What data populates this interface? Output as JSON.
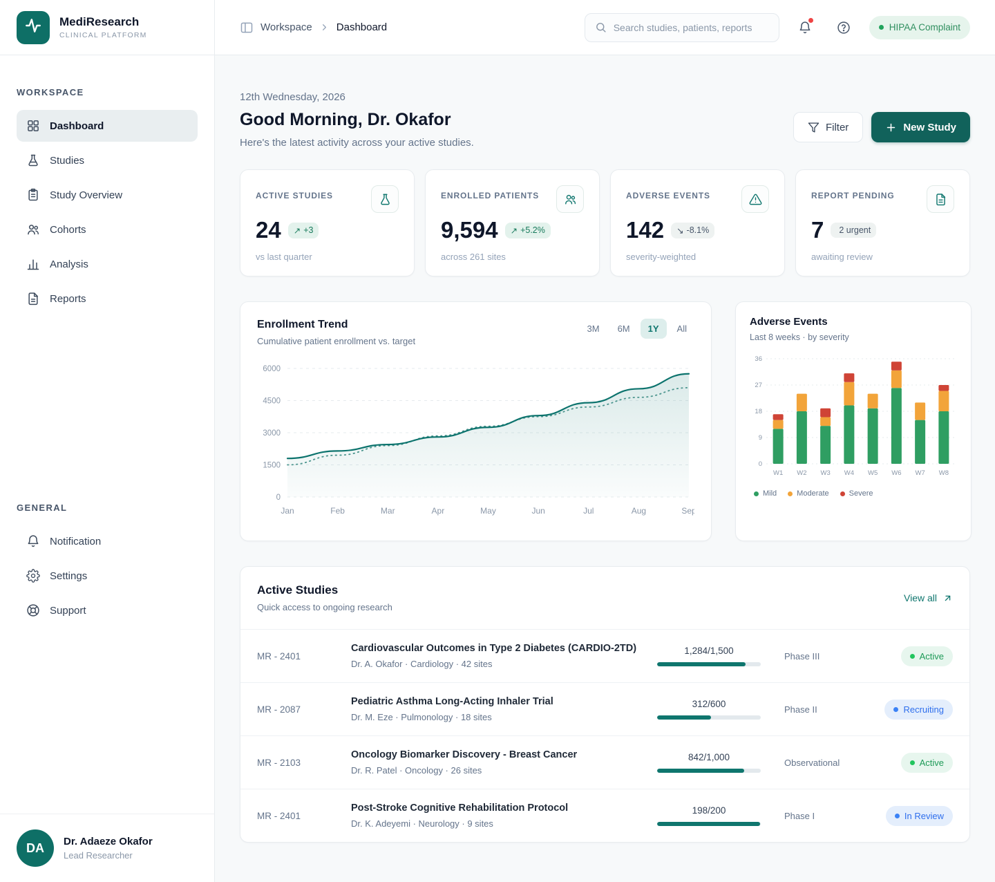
{
  "brand": {
    "name": "MediResearch",
    "tagline": "CLINICAL PLATFORM"
  },
  "topbar": {
    "breadcrumb": {
      "root": "Workspace",
      "current": "Dashboard"
    },
    "search_placeholder": "Search studies, patients, reports",
    "hipaa_badge": "HIPAA Complaint"
  },
  "sidebar": {
    "sections": {
      "workspace": "WORKSPACE",
      "general": "GENERAL"
    },
    "workspace_items": [
      {
        "label": "Dashboard",
        "icon": "grid-icon",
        "active": true
      },
      {
        "label": "Studies",
        "icon": "flask-icon",
        "active": false
      },
      {
        "label": "Study Overview",
        "icon": "clipboard-icon",
        "active": false
      },
      {
        "label": "Cohorts",
        "icon": "users-icon",
        "active": false
      },
      {
        "label": "Analysis",
        "icon": "bar-chart-icon",
        "active": false
      },
      {
        "label": "Reports",
        "icon": "document-icon",
        "active": false
      }
    ],
    "general_items": [
      {
        "label": "Notification",
        "icon": "bell-icon"
      },
      {
        "label": "Settings",
        "icon": "gear-icon"
      },
      {
        "label": "Support",
        "icon": "life-buoy-icon"
      }
    ],
    "user": {
      "initials": "DA",
      "name": "Dr. Adaeze Okafor",
      "role": "Lead Researcher"
    }
  },
  "header": {
    "date": "12th Wednesday, 2026",
    "greeting": "Good Morning, Dr. Okafor",
    "subtitle": "Here's the latest activity across your active studies.",
    "filter_button": "Filter",
    "new_study_button": "New Study"
  },
  "stat_cards": [
    {
      "label": "ACTIVE STUDIES",
      "value": "24",
      "badge": "+3",
      "badge_trend": "up",
      "sub": "vs last quarter",
      "icon": "flask-icon"
    },
    {
      "label": "ENROLLED PATIENTS",
      "value": "9,594",
      "badge": "+5.2%",
      "badge_trend": "up",
      "sub": "across 261 sites",
      "icon": "users-icon"
    },
    {
      "label": "ADVERSE EVENTS",
      "value": "142",
      "badge": "-8.1%",
      "badge_trend": "down",
      "sub": "severity-weighted",
      "icon": "alert-triangle-icon"
    },
    {
      "label": "REPORT PENDING",
      "value": "7",
      "badge": "2 urgent",
      "badge_trend": "neutral",
      "sub": "awaiting review",
      "icon": "file-icon"
    }
  ],
  "chart_data": [
    {
      "type": "area",
      "title": "Enrollment Trend",
      "subtitle": "Cumulative patient enrollment vs. target",
      "range_buttons": [
        "3M",
        "6M",
        "1Y",
        "All"
      ],
      "active_range": "1Y",
      "x": [
        "Jan",
        "Feb",
        "Mar",
        "Apr",
        "May",
        "Jun",
        "Jul",
        "Aug",
        "Sep"
      ],
      "series": [
        {
          "name": "Enrollment",
          "style": "solid",
          "color": "#0c736d",
          "values": [
            1800,
            2150,
            2450,
            2800,
            3250,
            3800,
            4400,
            5050,
            5750
          ]
        },
        {
          "name": "Target",
          "style": "dotted",
          "color": "#4a948d",
          "values": [
            1500,
            1950,
            2400,
            2850,
            3300,
            3750,
            4200,
            4650,
            5100
          ]
        }
      ],
      "ylim": [
        0,
        6000
      ],
      "yticks": [
        0,
        1500,
        3000,
        4500,
        6000
      ],
      "grid": true,
      "legend": "none"
    },
    {
      "type": "bar",
      "stacked": true,
      "title": "Adverse Events",
      "subtitle": "Last 8 weeks · by severity",
      "categories": [
        "W1",
        "W2",
        "W3",
        "W4",
        "W5",
        "W6",
        "W7",
        "W8"
      ],
      "series": [
        {
          "name": "Mild",
          "color": "#2f9e62",
          "values": [
            12,
            18,
            13,
            20,
            19,
            26,
            15,
            18
          ]
        },
        {
          "name": "Moderate",
          "color": "#f2a43a",
          "values": [
            3,
            6,
            3,
            8,
            5,
            6,
            6,
            7
          ]
        },
        {
          "name": "Severe",
          "color": "#cf4436",
          "values": [
            2,
            0,
            3,
            3,
            0,
            3,
            0,
            2
          ]
        }
      ],
      "ylim": [
        0,
        36
      ],
      "yticks": [
        0,
        9,
        18,
        27,
        36
      ],
      "grid": true,
      "legend_position": "bottom"
    }
  ],
  "active_studies": {
    "title": "Active Studies",
    "subtitle": "Quick access to ongoing research",
    "view_all": "View all",
    "rows": [
      {
        "code": "MR - 2401",
        "title": "Cardiovascular Outcomes in Type 2 Diabetes (CARDIO-2TD)",
        "meta": "Dr. A. Okafor · Cardiology · 42 sites",
        "enrolled": 1284,
        "target": 1500,
        "progress_label": "1,284/1,500",
        "phase": "Phase III",
        "status": "Active",
        "status_type": "green"
      },
      {
        "code": "MR - 2087",
        "title": "Pediatric Asthma Long-Acting Inhaler Trial",
        "meta": "Dr. M. Eze · Pulmonology · 18 sites",
        "enrolled": 312,
        "target": 600,
        "progress_label": "312/600",
        "phase": "Phase II",
        "status": "Recruiting",
        "status_type": "blue"
      },
      {
        "code": "MR - 2103",
        "title": "Oncology Biomarker Discovery - Breast Cancer",
        "meta": "Dr. R. Patel · Oncology · 26 sites",
        "enrolled": 842,
        "target": 1000,
        "progress_label": "842/1,000",
        "phase": "Observational",
        "status": "Active",
        "status_type": "green"
      },
      {
        "code": "MR - 2401",
        "title": "Post-Stroke Cognitive Rehabilitation Protocol",
        "meta": "Dr. K. Adeyemi · Neurology · 9 sites",
        "enrolled": 198,
        "target": 200,
        "progress_label": "198/200",
        "phase": "Phase I",
        "status": "In Review",
        "status_type": "blue"
      }
    ]
  },
  "colors": {
    "primary": "#0f766e",
    "primary_dark": "#11625b",
    "mild": "#2f9e62",
    "moderate": "#f2a43a",
    "severe": "#cf4436",
    "status_active": "#1d9a57",
    "status_blue": "#2f6fed",
    "alert": "#ef4444"
  }
}
